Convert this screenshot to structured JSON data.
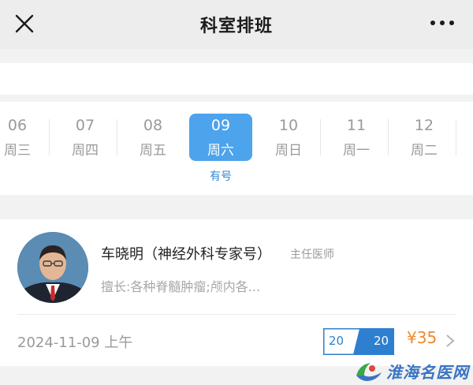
{
  "header": {
    "title": "科室排班",
    "close_icon": "close-icon",
    "more_icon": "more-icon"
  },
  "schedule": {
    "days": [
      {
        "date": "06",
        "weekday": "周三",
        "selected": false
      },
      {
        "date": "07",
        "weekday": "周四",
        "selected": false
      },
      {
        "date": "08",
        "weekday": "周五",
        "selected": false
      },
      {
        "date": "09",
        "weekday": "周六",
        "selected": true
      },
      {
        "date": "10",
        "weekday": "周日",
        "selected": false
      },
      {
        "date": "11",
        "weekday": "周一",
        "selected": false
      },
      {
        "date": "12",
        "weekday": "周二",
        "selected": false
      }
    ],
    "availability_label": "有号"
  },
  "doctor": {
    "name": "车晓明（神经外科专家号）",
    "title": "主任医师",
    "specialty": "擅长:各种脊髓肿瘤;颅内各...",
    "slot": {
      "date": "2024-11-09 上午",
      "quota_remaining": "20",
      "quota_total": "20",
      "price": "¥35"
    }
  },
  "watermark": {
    "text": "淮海名医网"
  },
  "colors": {
    "accent": "#4da3ec",
    "price": "#f0892a",
    "link": "#2f86d6"
  }
}
